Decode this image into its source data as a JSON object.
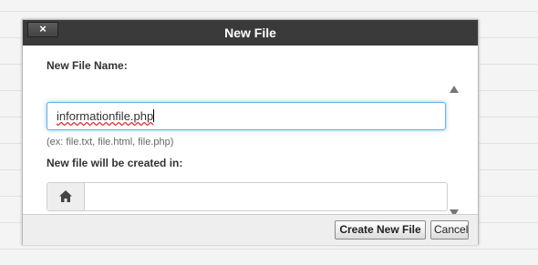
{
  "dialog": {
    "title": "New File",
    "close_label": "×"
  },
  "form": {
    "file_name_label": "New File Name:",
    "file_name_value": "informationfile.php",
    "file_name_hint": "(ex: file.txt, file.html, file.php)",
    "location_label": "New file will be created in:",
    "location_value": "",
    "location_icon": "home-icon"
  },
  "footer": {
    "create_label": "Create New File",
    "cancel_label": "Cancel"
  },
  "colors": {
    "titlebar": "#3a3a3a",
    "focus_ring": "#66afe9"
  }
}
